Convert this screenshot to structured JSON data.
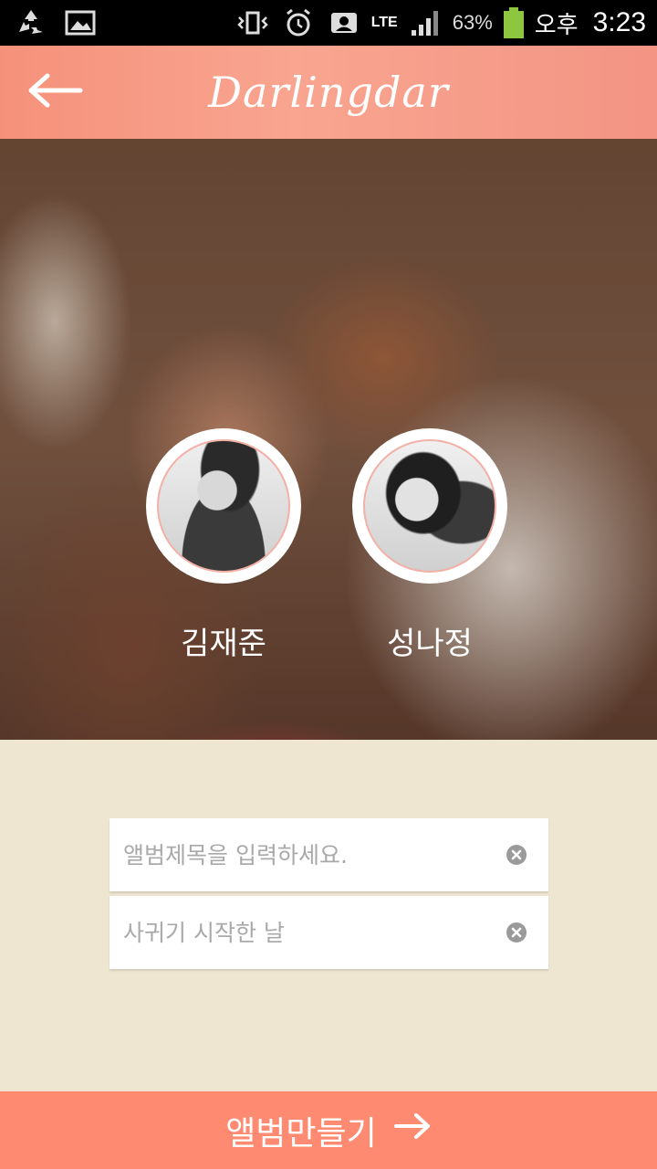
{
  "status_bar": {
    "battery_percent": "63%",
    "network": "LTE",
    "ampm": "오후",
    "time": "3:23",
    "icons": [
      "recycle-icon",
      "gallery-icon",
      "vibrate-icon",
      "alarm-icon",
      "voicemail-icon",
      "signal-icon",
      "battery-icon"
    ]
  },
  "header": {
    "title": "Darlingdar",
    "back_icon": "arrow-left-icon"
  },
  "couple": {
    "partner1": {
      "name": "김재준"
    },
    "partner2": {
      "name": "성나정"
    }
  },
  "form": {
    "album_title": {
      "placeholder": "앨범제목을 입력하세요.",
      "value": ""
    },
    "start_date": {
      "placeholder": "사귀기 시작한 날",
      "value": ""
    }
  },
  "actions": {
    "create_album_label": "앨범만들기",
    "create_album_icon": "arrow-right-icon"
  },
  "colors": {
    "header": "#f9a590",
    "button": "#ff8a72",
    "background": "#efe6d2"
  }
}
